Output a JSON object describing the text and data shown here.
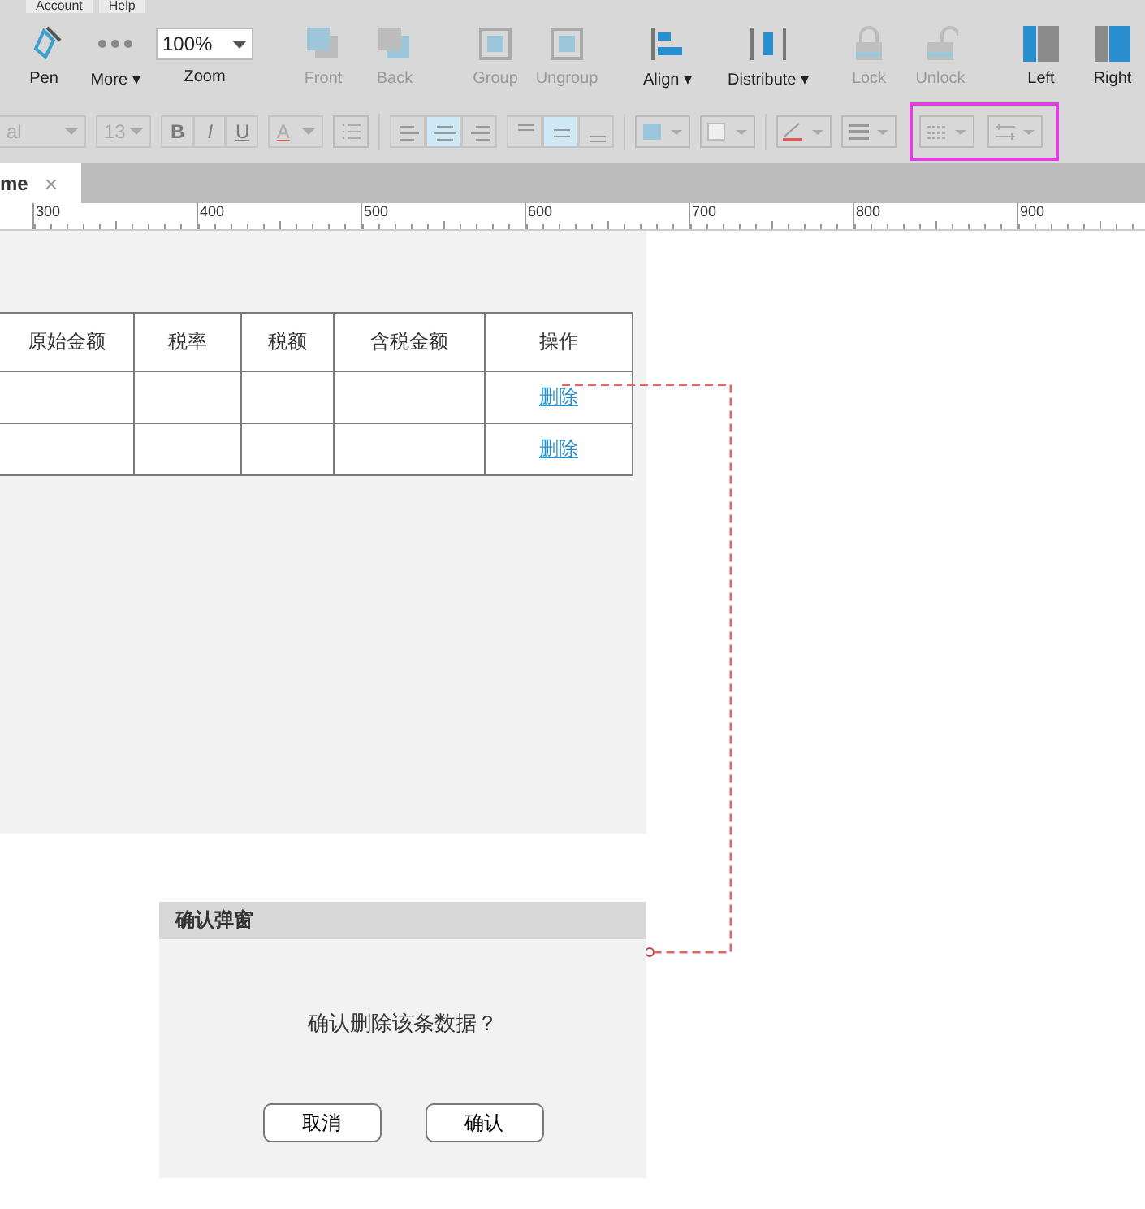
{
  "menu": [
    "Account",
    "Help"
  ],
  "toolbar": [
    {
      "kind": "pen",
      "label": "Pen",
      "disabled": false
    },
    {
      "kind": "more",
      "label": "More ▾",
      "disabled": false
    },
    {
      "kind": "zoom",
      "label": "Zoom",
      "value": "100%",
      "disabled": false
    },
    {
      "kind": "front",
      "label": "Front",
      "disabled": true
    },
    {
      "kind": "back",
      "label": "Back",
      "disabled": true
    },
    {
      "kind": "group",
      "label": "Group",
      "disabled": true
    },
    {
      "kind": "ungroup",
      "label": "Ungroup",
      "disabled": true
    },
    {
      "kind": "align",
      "label": "Align ▾",
      "disabled": false
    },
    {
      "kind": "distribute",
      "label": "Distribute ▾",
      "disabled": false
    },
    {
      "kind": "lock",
      "label": "Lock",
      "disabled": true
    },
    {
      "kind": "unlock",
      "label": "Unlock",
      "disabled": true
    },
    {
      "kind": "left",
      "label": "Left",
      "disabled": false
    },
    {
      "kind": "right",
      "label": "Right",
      "disabled": false
    }
  ],
  "format_toolbar": {
    "font": "al",
    "size": "13",
    "styles": [
      "B",
      "I",
      "U"
    ],
    "font_color": "A",
    "h_align": [
      {
        "kind": "left",
        "selected": false
      },
      {
        "kind": "center",
        "selected": true
      },
      {
        "kind": "right",
        "selected": false
      }
    ],
    "v_align": [
      {
        "kind": "top",
        "selected": false
      },
      {
        "kind": "middle",
        "selected": true
      },
      {
        "kind": "bottom",
        "selected": false
      }
    ]
  },
  "tab": {
    "label": "me",
    "close": "×"
  },
  "ruler": [
    "300",
    "400",
    "500",
    "600",
    "700",
    "800",
    "900"
  ],
  "table": {
    "columns": [
      "原始金额",
      "税率",
      "税额",
      "含税金额",
      "操作"
    ],
    "rows": [
      {
        "action": "删除"
      },
      {
        "action": "删除"
      }
    ]
  },
  "dialog": {
    "title": "确认弹窗",
    "message": "确认删除该条数据？",
    "buttons": [
      "取消",
      "确认"
    ]
  }
}
